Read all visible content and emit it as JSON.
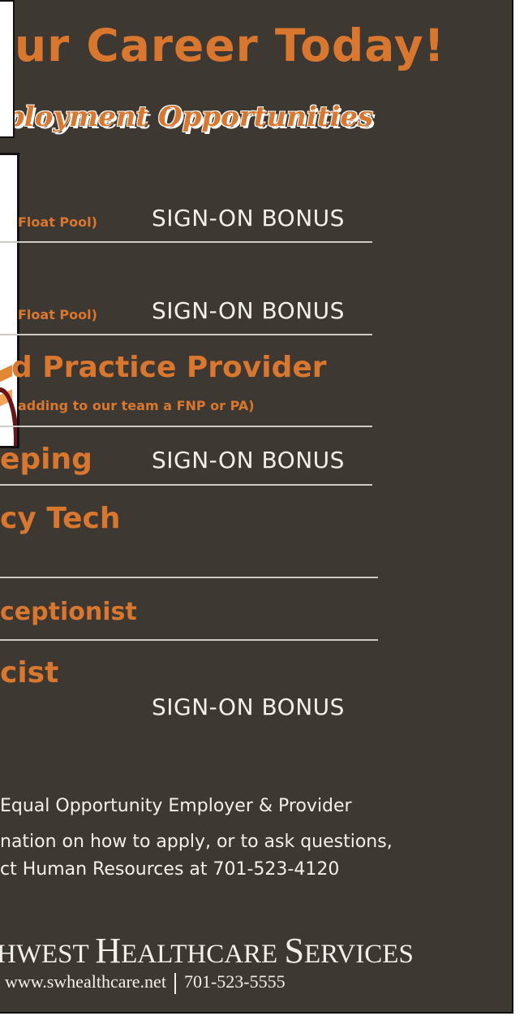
{
  "headline": "ur Career Today!",
  "subheading": "ployment Opportunities",
  "jobs": [
    {
      "detail": "Float Pool)",
      "bonus": "SIGN-ON BONUS"
    },
    {
      "detail": "Float Pool)",
      "bonus": "SIGN-ON BONUS"
    },
    {
      "title": "d Practice Provider",
      "detail": "adding to our team a FNP or PA)"
    },
    {
      "title": "eping",
      "bonus": "SIGN-ON BONUS"
    },
    {
      "title": "cy Tech"
    },
    {
      "title": "ceptionist"
    },
    {
      "title": "cist",
      "bonus": "SIGN-ON BONUS"
    }
  ],
  "footer": {
    "eeo": "Equal Opportunity Employer & Provider",
    "apply_line1": "nation on how to apply, or to ask questions,",
    "apply_line2": "ct Human Resources at 701-523-4120"
  },
  "brand": {
    "part1": "HWEST ",
    "h": "H",
    "part2": "EALTHCARE ",
    "s": "S",
    "part3": "ERVICES"
  },
  "contact": {
    "website": "www.swhealthcare.net",
    "phone": "701-523-5555"
  },
  "colors": {
    "background": "#3d3832",
    "accent": "#d9772e",
    "text": "#f3efe9"
  }
}
